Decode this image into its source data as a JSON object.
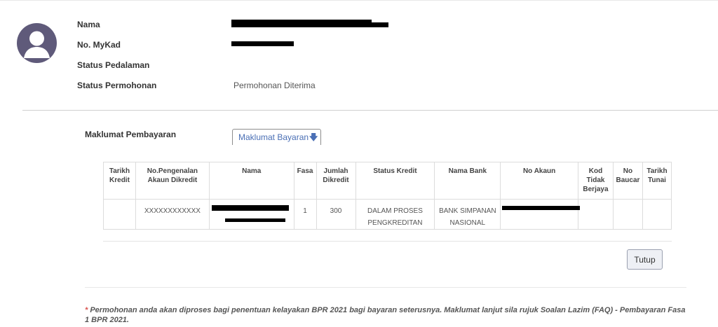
{
  "profile": {
    "avatar_icon": "user-avatar-icon",
    "fields": [
      {
        "label": "Nama",
        "value": ""
      },
      {
        "label": "No. MyKad",
        "value": ""
      },
      {
        "label": "Status Pedalaman",
        "value": ""
      },
      {
        "label": "Status Permohonan",
        "value": "Permohonan Diterima"
      }
    ]
  },
  "payment": {
    "section_label": "Maklumat Pembayaran",
    "toggle_label": "Maklumat Bayaran",
    "toggle_icon": "arrow-down-icon",
    "accent_color": "#4a6fb5"
  },
  "table": {
    "headers": [
      "Tarikh Kredit",
      "No.Pengenalan Akaun Dikredit",
      "Nama",
      "Fasa",
      "Jumlah Dikredit",
      "Status Kredit",
      "Nama Bank",
      "No Akaun",
      "Kod Tidak Berjaya",
      "No Baucar",
      "Tarikh Tunai"
    ],
    "rows": [
      {
        "tarikh_kredit": "",
        "no_pengenalan": "XXXXXXXXXXXX",
        "nama": "",
        "fasa": "1",
        "jumlah": "300",
        "status": "DALAM PROSES PENGKREDITAN",
        "bank": "BANK SIMPANAN NASIONAL",
        "no_akaun": "",
        "kod": "",
        "baucar": "",
        "tarikh_tunai": ""
      }
    ]
  },
  "actions": {
    "close_label": "Tutup"
  },
  "footer": {
    "star": "*",
    "note": "Permohonan anda akan diproses bagi penentuan kelayakan BPR 2021 bagi bayaran seterusnya. Maklumat lanjut sila rujuk Soalan Lazim (FAQ) - Pembayaran Fasa 1 BPR 2021."
  }
}
